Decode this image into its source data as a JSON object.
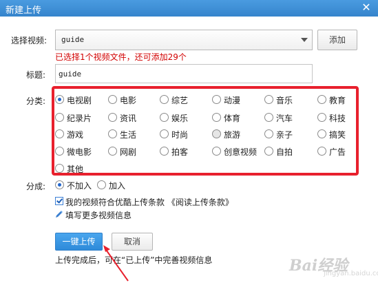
{
  "window": {
    "title": "新建上传",
    "close_symbol": "✕"
  },
  "form": {
    "video_label": "选择视频:",
    "video_value": "guide",
    "add_button": "添加",
    "notice": "已选择1个视频文件，还可添加29个",
    "title_label": "标题:",
    "title_value": "guide",
    "category_label": "分类:",
    "selected_category": "电视剧",
    "categories": [
      "电视剧",
      "电影",
      "综艺",
      "动漫",
      "音乐",
      "教育",
      "纪录片",
      "资讯",
      "娱乐",
      "体育",
      "汽车",
      "科技",
      "游戏",
      "生活",
      "时尚",
      "旅游",
      "亲子",
      "搞笑",
      "微电影",
      "网剧",
      "拍客",
      "创意视频",
      "自拍",
      "广告",
      "其他"
    ],
    "split_label": "分成:",
    "split_options": [
      "不加入",
      "加入"
    ],
    "agreement_text": "我的视频符合优酷上传条款 《阅读上传条款》",
    "more_info_link": "填写更多视频信息",
    "upload_button": "一键上传",
    "cancel_button": "取消",
    "footer_text": "上传完成后，可在“已上传”中完善视频信息"
  },
  "watermark": {
    "brand": "Bai",
    "brand_suffix": "经验",
    "sub": "jingyan.baidu.com"
  },
  "colors": {
    "titlebar": "#3584cc",
    "highlight_box": "#e8202d",
    "notice": "#d20000",
    "primary_button": "#2e8ad9"
  }
}
